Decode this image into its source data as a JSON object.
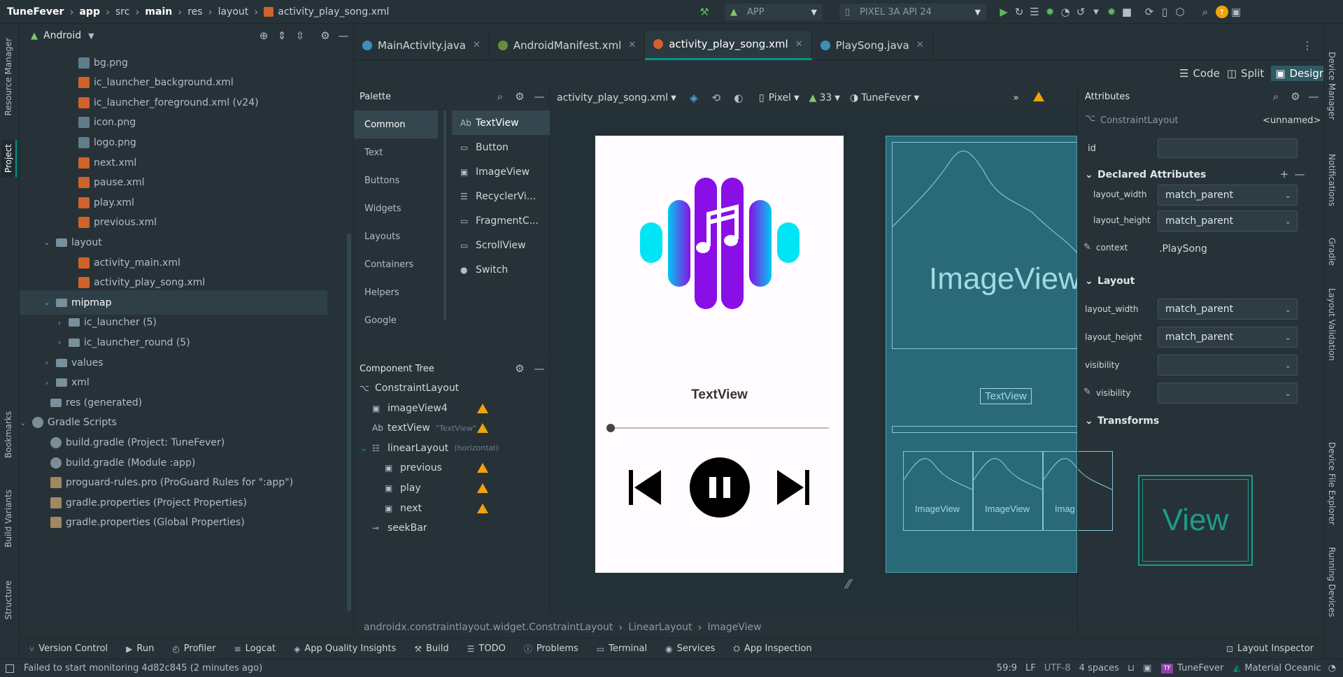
{
  "titlebar": {
    "project": "TuneFever",
    "crumbs": [
      "app",
      "src",
      "main",
      "res",
      "layout"
    ],
    "file": "activity_play_song.xml",
    "run_config": "APP",
    "device": "PIXEL 3A API 24"
  },
  "left_strip": {
    "tabs": [
      "Resource Manager",
      "Project",
      "Bookmarks",
      "Build Variants",
      "Structure"
    ]
  },
  "right_strip": {
    "tabs": [
      "Device Manager",
      "Notifications",
      "Gradle",
      "Layout Validation",
      "Device File Explorer",
      "Running Devices"
    ]
  },
  "project_panel": {
    "view": "Android",
    "items": [
      {
        "label": "bg.png",
        "icon": "png"
      },
      {
        "label": "ic_launcher_background.xml",
        "icon": "xml"
      },
      {
        "label": "ic_launcher_foreground.xml (v24)",
        "icon": "xml"
      },
      {
        "label": "icon.png",
        "icon": "png"
      },
      {
        "label": "logo.png",
        "icon": "png"
      },
      {
        "label": "next.xml",
        "icon": "xml"
      },
      {
        "label": "pause.xml",
        "icon": "xml"
      },
      {
        "label": "play.xml",
        "icon": "xml"
      },
      {
        "label": "previous.xml",
        "icon": "xml"
      },
      {
        "label": "layout",
        "icon": "folder"
      },
      {
        "label": "activity_main.xml",
        "icon": "xml"
      },
      {
        "label": "activity_play_song.xml",
        "icon": "xml"
      },
      {
        "label": "mipmap",
        "icon": "folder"
      },
      {
        "label": "ic_launcher (5)",
        "icon": "folder"
      },
      {
        "label": "ic_launcher_round (5)",
        "icon": "folder"
      },
      {
        "label": "values",
        "icon": "folder"
      },
      {
        "label": "xml",
        "icon": "folder"
      },
      {
        "label": "res (generated)",
        "icon": "folder"
      },
      {
        "label": "Gradle Scripts",
        "icon": "gradle"
      },
      {
        "label": "build.gradle (Project: TuneFever)",
        "icon": "gradle"
      },
      {
        "label": "build.gradle (Module :app)",
        "icon": "gradle"
      },
      {
        "label": "proguard-rules.pro (ProGuard Rules for \":app\")",
        "icon": "props"
      },
      {
        "label": "gradle.properties (Project Properties)",
        "icon": "props"
      },
      {
        "label": "gradle.properties (Global Properties)",
        "icon": "props"
      }
    ]
  },
  "editor_tabs": [
    {
      "label": "MainActivity.java",
      "color": "#3d8eb9"
    },
    {
      "label": "AndroidManifest.xml",
      "color": "#6a8c3a"
    },
    {
      "label": "activity_play_song.xml",
      "color": "#d0622b"
    },
    {
      "label": "PlaySong.java",
      "color": "#3d8eb9"
    }
  ],
  "view_modes": {
    "code": "Code",
    "split": "Split",
    "design": "Design"
  },
  "palette": {
    "title": "Palette",
    "categories": [
      "Common",
      "Text",
      "Buttons",
      "Widgets",
      "Layouts",
      "Containers",
      "Helpers",
      "Google"
    ],
    "items": [
      {
        "glyph": "Ab",
        "label": "TextView"
      },
      {
        "glyph": "▭",
        "label": "Button"
      },
      {
        "glyph": "▣",
        "label": "ImageView"
      },
      {
        "glyph": "☰",
        "label": "RecyclerVi..."
      },
      {
        "glyph": "▭",
        "label": "FragmentC..."
      },
      {
        "glyph": "▭",
        "label": "ScrollView"
      },
      {
        "glyph": "●",
        "label": "Switch"
      }
    ]
  },
  "design_toolbar": {
    "file": "activity_play_song.xml",
    "device": "Pixel",
    "api": "33",
    "theme": "TuneFever",
    "margin": "0dp"
  },
  "component_tree": {
    "title": "Component Tree",
    "items": [
      {
        "glyph": "⌥",
        "label": "ConstraintLayout",
        "sub": ""
      },
      {
        "glyph": "▣",
        "label": "imageView4",
        "sub": ""
      },
      {
        "glyph": "Ab",
        "label": "textView",
        "sub": "\"TextView\""
      },
      {
        "glyph": "☷",
        "label": "linearLayout",
        "sub": "(horizontal)"
      },
      {
        "glyph": "▣",
        "label": "previous",
        "sub": ""
      },
      {
        "glyph": "▣",
        "label": "play",
        "sub": ""
      },
      {
        "glyph": "▣",
        "label": "next",
        "sub": ""
      },
      {
        "glyph": "⊸",
        "label": "seekBar",
        "sub": ""
      }
    ]
  },
  "preview": {
    "title_text": "TextView",
    "seek_progress": 0
  },
  "blueprint": {
    "image_label": "ImageView",
    "text_label": "TextView",
    "button_labels": [
      "ImageView",
      "ImageView",
      "Imag"
    ]
  },
  "attributes": {
    "title": "Attributes",
    "component": "ConstraintLayout",
    "name": "<unnamed>",
    "id_label": "id",
    "id_value": "",
    "declared_title": "Declared Attributes",
    "declared": [
      {
        "label": "layout_width",
        "value": "match_parent"
      },
      {
        "label": "layout_height",
        "value": "match_parent"
      }
    ],
    "context_label": "context",
    "context_value": ".PlaySong",
    "layout_title": "Layout",
    "layout": [
      {
        "label": "layout_width",
        "value": "match_parent"
      },
      {
        "label": "layout_height",
        "value": "match_parent"
      },
      {
        "label": "visibility",
        "value": ""
      },
      {
        "label": "visibility",
        "value": ""
      }
    ],
    "transforms_title": "Transforms",
    "view_preview": "View"
  },
  "breadcrumb": [
    "androidx.constraintlayout.widget.ConstraintLayout",
    "LinearLayout",
    "ImageView"
  ],
  "bottom_tools": [
    "Version Control",
    "Run",
    "Profiler",
    "Logcat",
    "App Quality Insights",
    "Build",
    "TODO",
    "Problems",
    "Terminal",
    "Services",
    "App Inspection"
  ],
  "layout_inspector": "Layout Inspector",
  "status": {
    "message": "Failed to start monitoring 4d82c845 (2 minutes ago)",
    "position": "59:9",
    "line_sep": "LF",
    "encoding": "UTF-8",
    "indent": "4 spaces",
    "project": "TuneFever",
    "theme": "Material Oceanic"
  },
  "colors": {
    "accent": "#009688",
    "warning": "#f0a30a",
    "purple": "#8a0ee6",
    "cyan": "#00e5f5"
  }
}
